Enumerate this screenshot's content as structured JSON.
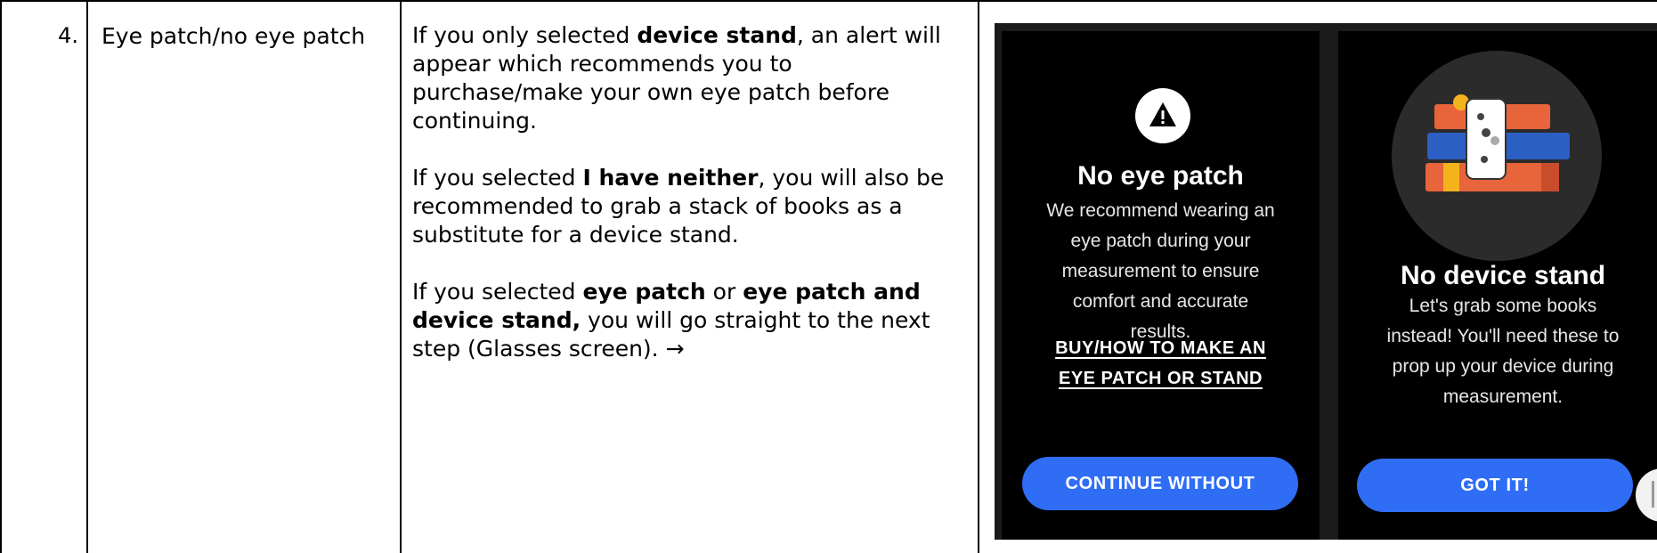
{
  "row": {
    "number": "4.",
    "topic": "Eye patch/no eye patch"
  },
  "description": {
    "p1_pre": "If you only selected ",
    "p1_bold": "device stand",
    "p1_post": ", an alert will appear which recommends you to purchase/make your own eye patch before continuing.",
    "p2_pre": "If you selected ",
    "p2_bold": "I have neither",
    "p2_post": ", you will also be recommended to grab a stack of books as a substitute for a device stand.",
    "p3_pre": "If you selected ",
    "p3_bold1": "eye patch",
    "p3_mid": " or ",
    "p3_bold2": "eye patch and device stand,",
    "p3_post": " you will go straight to the next step (Glasses screen). →"
  },
  "screen_left": {
    "icon": "warning-icon",
    "title": "No eye patch",
    "body_lines": [
      "We recommend wearing an",
      "eye patch during your",
      "measurement to ensure",
      "comfort and accurate",
      "results."
    ],
    "link_lines": [
      "BUY/HOW TO MAKE AN",
      "EYE PATCH OR STAND"
    ],
    "button": "CONTINUE WITHOUT"
  },
  "screen_right": {
    "icon": "books-phone-illustration",
    "title": "No device stand",
    "body_lines": [
      "Let's grab some books",
      "instead! You'll need these to",
      "prop up your device during",
      "measurement."
    ],
    "button": "GOT IT!"
  },
  "colors": {
    "button_blue": "#2f6df4",
    "panel_bg": "#000000"
  }
}
